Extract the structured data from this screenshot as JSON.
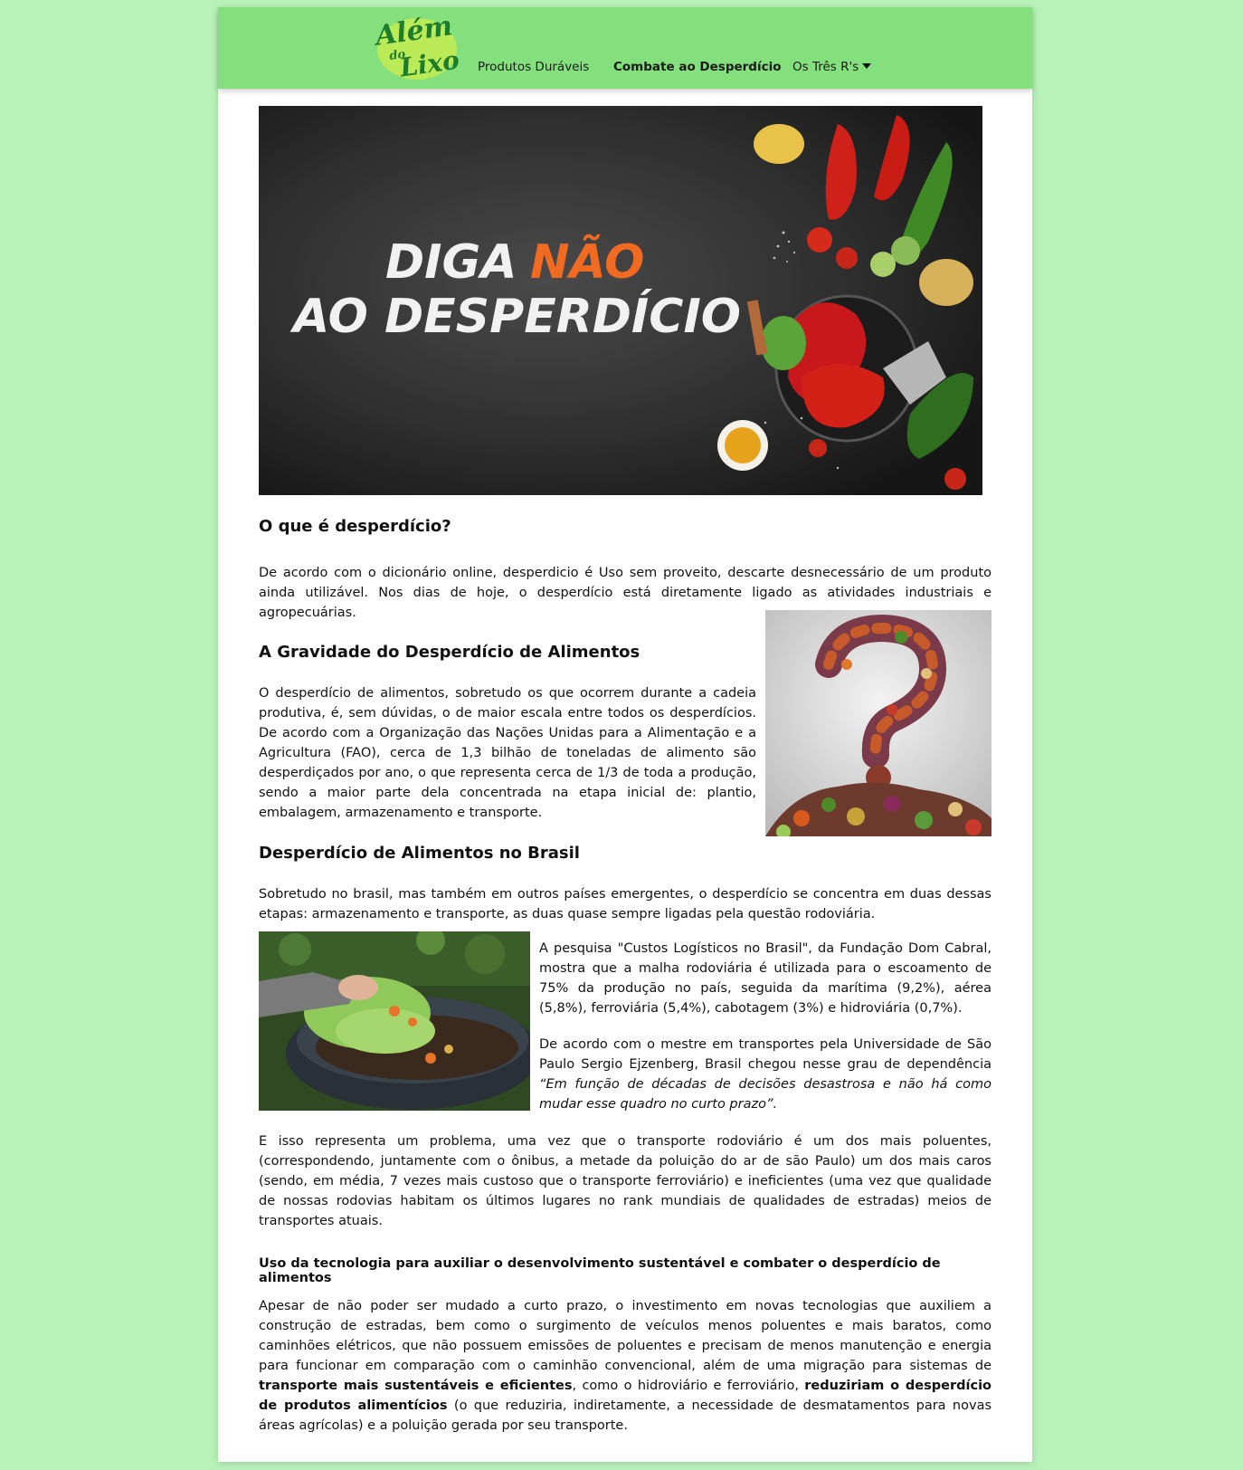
{
  "nav": {
    "logo_text": "Além do Lixo",
    "links": [
      {
        "label": "Produtos Duráveis"
      },
      {
        "label": "Combate ao Desperdício"
      },
      {
        "label": "Os Três R's"
      }
    ]
  },
  "hero": {
    "line1_a": "DIGA",
    "line1_b": "NÃO",
    "line2": "AO DESPERDÍCIO"
  },
  "sections": {
    "s1_title": "O que é desperdício?",
    "s1_p": "De acordo com o dicionário online, desperdicio é Uso sem proveito, descarte desnecessário de um produto ainda utilizável. Nos dias de hoje, o desperdício está diretamente ligado as atividades industriais e agropecuárias.",
    "s2_title": "A Gravidade do Desperdício de Alimentos",
    "s2_p": "O desperdício de alimentos, sobretudo os que ocorrem durante a cadeia produtiva, é, sem dúvidas, o de maior escala entre todos os desperdícios. De acordo com a Organização das Nações Unidas para a Alimentação e a Agricultura (FAO), cerca de 1,3 bilhão de toneladas de alimento são desperdiçados por ano, o que representa cerca de 1/3 de toda a produção, sendo a maior parte dela concentrada na etapa inicial de: plantio, embalagem, armazenamento e transporte.",
    "s3_title": "Desperdício de Alimentos no Brasil",
    "s3_p1": "Sobretudo no brasil, mas também em outros países emergentes, o desperdício se concentra em duas dessas etapas: armazenamento e transporte, as duas quase sempre ligadas pela questão rodoviária.",
    "s3_p2": "A pesquisa \"Custos Logísticos no Brasil\", da Fundação Dom Cabral, mostra que a malha rodoviária é utilizada para o escoamento de 75% da produção no país, seguida da marítima (9,2%), aérea (5,8%), ferroviária (5,4%), cabotagem (3%) e hidroviária (0,7%).",
    "s3_p3_a": "De acordo com o mestre em transportes pela Universidade de São Paulo Sergio Ejzenberg, Brasil chegou nesse grau de dependência ",
    "s3_p3_quote": "“Em função de décadas de decisões desastrosa e não há como mudar esse quadro no curto prazo”.",
    "s3_p4": "E isso representa um problema, uma vez que o transporte rodoviário é um dos mais poluentes, (correspondendo, juntamente com o ônibus, a metade da poluição do ar de são Paulo) um dos mais caros (sendo, em média, 7 vezes mais custoso que o transporte ferroviário) e ineficientes (uma vez que qualidade de nossas rodovias habitam os últimos lugares no rank mundiais de qualidades de estradas) meios de transportes atuais.",
    "s4_title": "Uso da tecnologia para auxiliar o desenvolvimento sustentável e combater o desperdício de alimentos",
    "s4_p_a": "Apesar de não poder ser mudado a curto prazo, o investimento em novas tecnologias que auxiliem a construção de estradas, bem como o surgimento de veículos menos poluentes e mais baratos, como caminhões elétricos, que não possuem emissões de poluentes e precisam de menos manutenção e energia para funcionar em comparação com o caminhão convencional, além de uma migração para sistemas de ",
    "s4_p_b1": "transporte mais sustentáveis e eficientes",
    "s4_p_c": ", como o hidroviário e ferroviário, ",
    "s4_p_b2": "reduziriam o desperdício de produtos alimentícios",
    "s4_p_d": " (o que reduziria, indiretamente, a necessidade de desmatamentos para novas áreas agrícolas) e a poluição gerada por seu transporte."
  },
  "colors": {
    "background": "#b8f2b8",
    "navbar": "#84e07c",
    "logo_green": "#1e7d2a",
    "hero_orange": "#f06a22"
  }
}
